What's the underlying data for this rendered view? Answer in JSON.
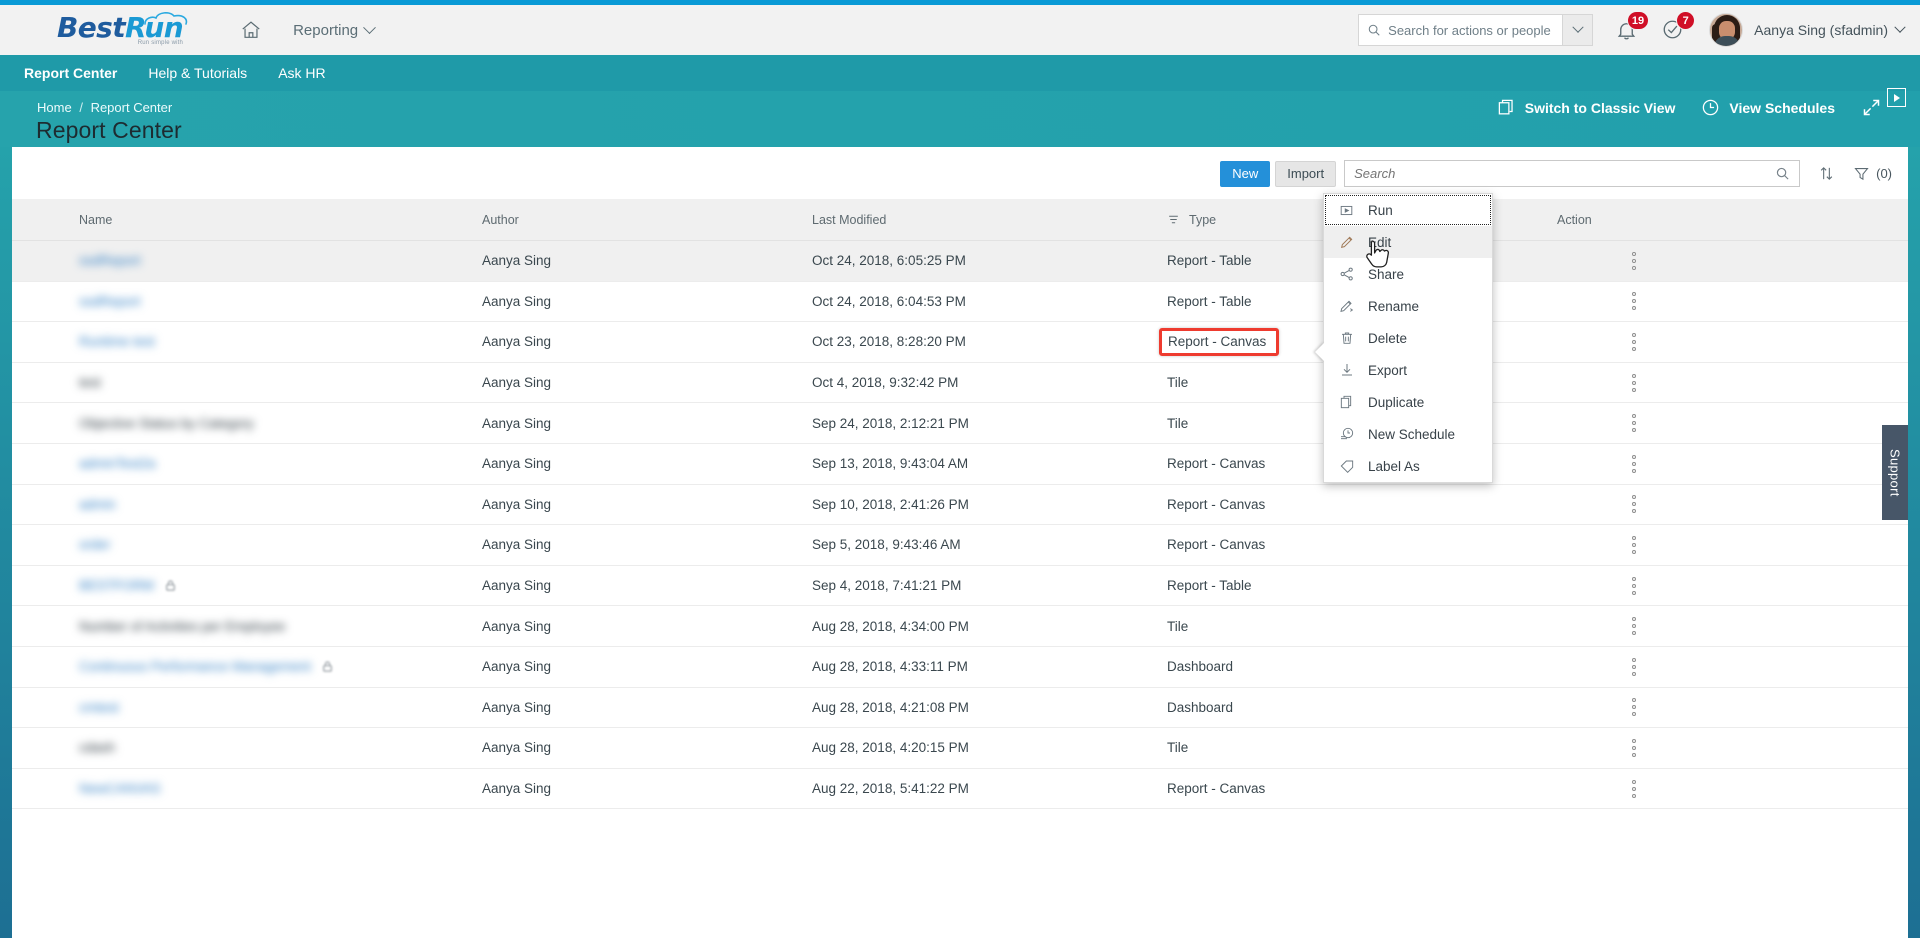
{
  "colors": {
    "accent_blue": "#0a9ad6",
    "teal": "#1f9aa8",
    "teal_band": "#26a3ac",
    "primary_button": "#2490d9",
    "badge_red": "#d00f27",
    "highlight_red": "#ee3b2f",
    "link_blue": "#2f7ec4",
    "support_tab": "#475668"
  },
  "header": {
    "logo": {
      "best": "Best",
      "run": "Run",
      "tagline": "Run simple with"
    },
    "home_icon": "home-icon",
    "nav": {
      "label": "Reporting",
      "chevron": "chevron-down-icon"
    },
    "search": {
      "placeholder": "Search for actions or people",
      "value": "",
      "icon": "search-icon",
      "dropdown_icon": "chevron-down-icon"
    },
    "notifications": {
      "icon": "bell-icon",
      "count": "19"
    },
    "tasks": {
      "icon": "check-circle-icon",
      "count": "7"
    },
    "user": {
      "name": "Aanya Sing (sfadmin)",
      "avatar": "avatar",
      "chevron": "chevron-down-icon"
    }
  },
  "teal_nav": {
    "items": [
      {
        "label": "Report Center",
        "active": true
      },
      {
        "label": "Help & Tutorials",
        "active": false
      },
      {
        "label": "Ask HR",
        "active": false
      }
    ]
  },
  "page": {
    "breadcrumb": {
      "home": "Home",
      "separator": "/",
      "current": "Report Center"
    },
    "title": "Report Center",
    "actions": [
      {
        "label": "Switch to Classic View",
        "icon": "copy-windows-icon"
      },
      {
        "label": "View Schedules",
        "icon": "clock-icon"
      }
    ],
    "expand_icon": "expand-fullscreen-icon",
    "collapse_chip_icon": "play-collapse-icon"
  },
  "toolbar": {
    "new_label": "New",
    "import_label": "Import",
    "search": {
      "placeholder": "Search",
      "value": "",
      "icon": "search-icon"
    },
    "sort_icon": "sort-arrows-icon",
    "filter_icon": "filter-funnel-icon",
    "filter_count": "(0)"
  },
  "table": {
    "columns": [
      {
        "key": "name",
        "label": "Name"
      },
      {
        "key": "author",
        "label": "Author"
      },
      {
        "key": "modified",
        "label": "Last Modified"
      },
      {
        "key": "type",
        "label": "Type",
        "icon": "column-filter-icon"
      },
      {
        "key": "action",
        "label": "Action"
      }
    ],
    "rows": [
      {
        "name": "ssdReport",
        "name_style": "link",
        "locked": false,
        "author": "Aanya Sing",
        "modified": "Oct 24, 2018, 6:05:25 PM",
        "type": "Report - Table",
        "highlight": false
      },
      {
        "name": "ssdReport",
        "name_style": "link",
        "locked": false,
        "author": "Aanya Sing",
        "modified": "Oct 24, 2018, 6:04:53 PM",
        "type": "Report - Table",
        "highlight": false
      },
      {
        "name": "Runtime test",
        "name_style": "link",
        "locked": false,
        "author": "Aanya Sing",
        "modified": "Oct 23, 2018, 8:28:20 PM",
        "type": "Report - Canvas",
        "highlight": true
      },
      {
        "name": "test",
        "name_style": "plain",
        "locked": false,
        "author": "Aanya Sing",
        "modified": "Oct 4, 2018, 9:32:42 PM",
        "type": "Tile",
        "highlight": false
      },
      {
        "name": "Objective Status by Category",
        "name_style": "plain",
        "locked": false,
        "author": "Aanya Sing",
        "modified": "Sep 24, 2018, 2:12:21 PM",
        "type": "Tile",
        "highlight": false
      },
      {
        "name": "adminTest2a",
        "name_style": "link",
        "locked": false,
        "author": "Aanya Sing",
        "modified": "Sep 13, 2018, 9:43:04 AM",
        "type": "Report - Canvas",
        "highlight": false
      },
      {
        "name": "admin",
        "name_style": "link",
        "locked": false,
        "author": "Aanya Sing",
        "modified": "Sep 10, 2018, 2:41:26 PM",
        "type": "Report - Canvas",
        "highlight": false
      },
      {
        "name": "order",
        "name_style": "link",
        "locked": false,
        "author": "Aanya Sing",
        "modified": "Sep 5, 2018, 9:43:46 AM",
        "type": "Report - Canvas",
        "highlight": false
      },
      {
        "name": "BESTFORM",
        "name_style": "link",
        "locked": true,
        "author": "Aanya Sing",
        "modified": "Sep 4, 2018, 7:41:21 PM",
        "type": "Report - Table",
        "highlight": false
      },
      {
        "name": "Number of Activities per Employee",
        "name_style": "plain",
        "locked": false,
        "author": "Aanya Sing",
        "modified": "Aug 28, 2018, 4:34:00 PM",
        "type": "Tile",
        "highlight": false
      },
      {
        "name": "Continuous Performance Management",
        "name_style": "link",
        "locked": true,
        "author": "Aanya Sing",
        "modified": "Aug 28, 2018, 4:33:11 PM",
        "type": "Dashboard",
        "highlight": false
      },
      {
        "name": "cmtest",
        "name_style": "link",
        "locked": false,
        "author": "Aanya Sing",
        "modified": "Aug 28, 2018, 4:21:08 PM",
        "type": "Dashboard",
        "highlight": false
      },
      {
        "name": "cdash",
        "name_style": "plain",
        "locked": false,
        "author": "Aanya Sing",
        "modified": "Aug 28, 2018, 4:20:15 PM",
        "type": "Tile",
        "highlight": false
      },
      {
        "name": "NewCANVAS",
        "name_style": "link",
        "locked": false,
        "author": "Aanya Sing",
        "modified": "Aug 22, 2018, 5:41:22 PM",
        "type": "Report - Canvas",
        "highlight": false
      }
    ],
    "kebab_icon": "more-vertical-icon"
  },
  "context_menu": {
    "items": [
      {
        "label": "Run",
        "icon": "play-box-icon",
        "focused": true,
        "hovered": false
      },
      {
        "label": "Edit",
        "icon": "pencil-icon",
        "focused": false,
        "hovered": true
      },
      {
        "label": "Share",
        "icon": "share-nodes-icon",
        "focused": false,
        "hovered": false
      },
      {
        "label": "Rename",
        "icon": "rename-pencil-icon",
        "focused": false,
        "hovered": false
      },
      {
        "label": "Delete",
        "icon": "trash-icon",
        "focused": false,
        "hovered": false
      },
      {
        "label": "Export",
        "icon": "download-icon",
        "focused": false,
        "hovered": false
      },
      {
        "label": "Duplicate",
        "icon": "duplicate-icon",
        "focused": false,
        "hovered": false
      },
      {
        "label": "New Schedule",
        "icon": "schedule-clock-icon",
        "focused": false,
        "hovered": false
      },
      {
        "label": "Label As",
        "icon": "tag-icon",
        "focused": false,
        "hovered": false
      }
    ]
  },
  "support": {
    "label": "Support"
  }
}
